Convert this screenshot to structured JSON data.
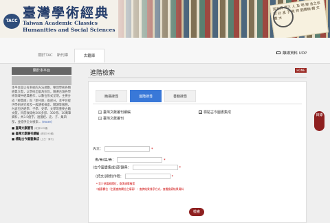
{
  "header": {
    "logo_text": "TACC",
    "title_zh": "臺灣學術經典",
    "title_en_1": "Taiwan Academic Classics",
    "title_en_2": "Humanities and Social Sciences",
    "scroll_text": "宣王師 得三 人 及 明 鄉 舍之也 對 日 孟 子 見 齊 劉寶楠 輯 文 章 大"
  },
  "nav": {
    "tabs": [
      "關於TAC",
      "新刊庫",
      "古籍庫"
    ],
    "active_tab": "古籍庫",
    "udp_label": "離線資料 UDP"
  },
  "sidebar": {
    "heading": "關於本平台",
    "description": "本平台是以有系統的方法規劃、整理學術各類經典文獻，以學術出版為宗旨，精選台灣各學術領域中經典著作，以數位形式呈現，主要分成「經典庫」與「新刊庫」兩部分，本平台提供學術研究者及一般讀者檢索、閱讀等服務，內容包括經學、子學、史學、文學等重要古籍文獻，目前收錄約200多部、300冊、10萬筆資料，共3.5億字，涵蓋經、史、子、集四部，並提供全文檢索...",
    "more": "(more)",
    "links": [
      {
        "label": "臺灣文獻叢刊",
        "note": "(收錄309種)"
      },
      {
        "label": "臺灣文獻叢刊續編",
        "note": "(收錄190種)"
      },
      {
        "label": "標點古今圖書集成",
        "note": "(上古~清代)"
      }
    ]
  },
  "main": {
    "title": "進階檢索",
    "home_label": "HOME",
    "search_tabs": [
      "簡易搜尋",
      "進階搜尋",
      "書籍搜尋"
    ],
    "active_search_tab": "進階搜尋",
    "sources": [
      {
        "label": "臺灣文獻叢刊續編",
        "checked": false
      },
      {
        "label": "臺灣文獻叢刊",
        "checked": false
      },
      {
        "label": "標點古今圖書集成",
        "checked": true
      }
    ],
    "fields": [
      {
        "label": "內文：",
        "value": ""
      },
      {
        "label": "書/卷/篇/卷：",
        "value": ""
      },
      {
        "label": "(古今圖書集成)部/匯典：",
        "value": ""
      },
      {
        "label": "(詩文/詞標)作者：",
        "value": ""
      }
    ],
    "required_mark": "*",
    "note_1": "* 至少須填寫欄位，查詢清單檢索",
    "note_2": "*檢索欄位（主要查詢欄位之填寫）：查詢結果排序方式，查看檢索結果資料",
    "search_button": "檢索"
  },
  "toc_button": "目錄"
}
